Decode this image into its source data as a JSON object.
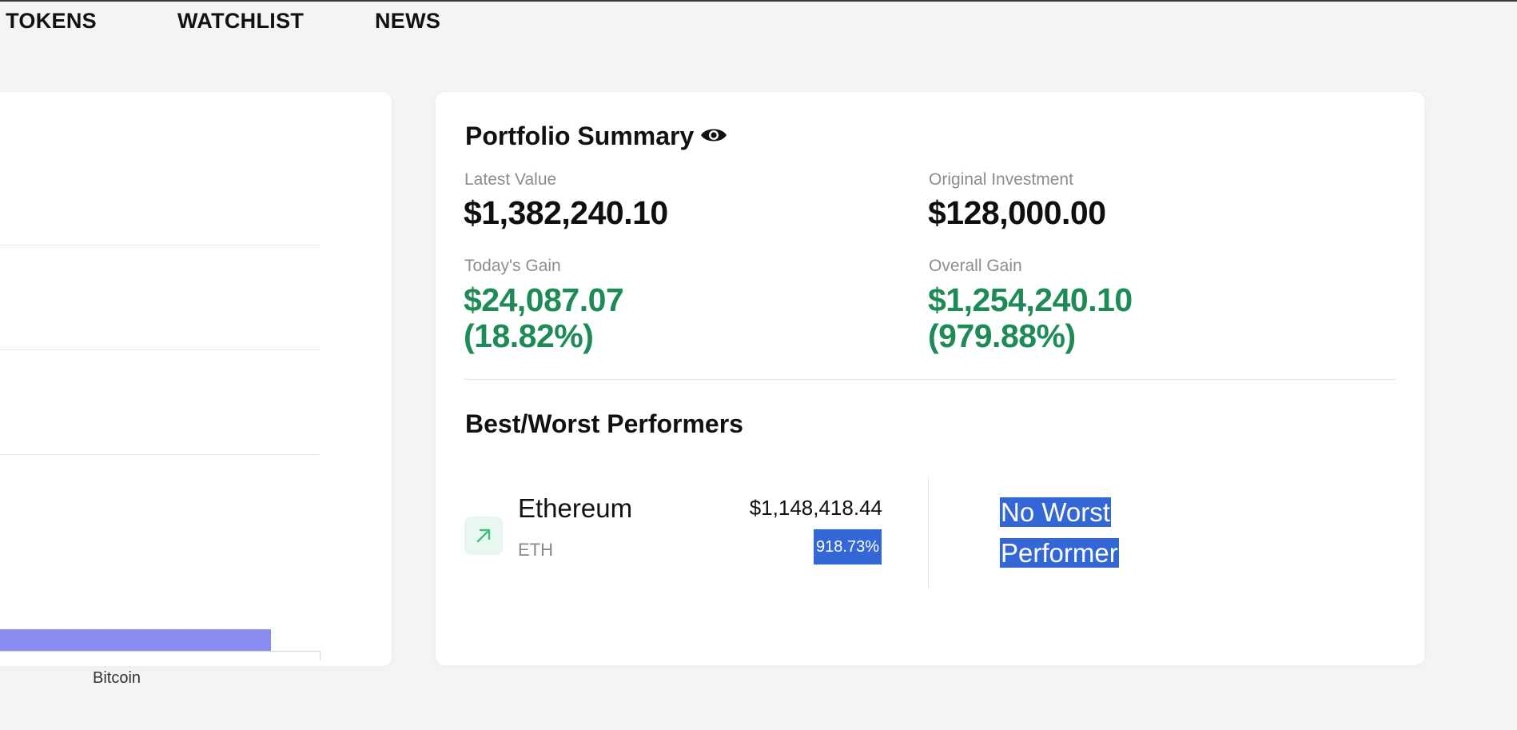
{
  "nav": {
    "items": [
      {
        "label": "O TOKENS"
      },
      {
        "label": "WATCHLIST"
      },
      {
        "label": "NEWS"
      }
    ]
  },
  "chart_data": {
    "type": "bar",
    "categories": [
      "Bitcoin"
    ],
    "values": [
      null
    ],
    "title": "",
    "xlabel": "",
    "ylabel": "",
    "grid": true
  },
  "summary": {
    "title": "Portfolio Summary",
    "title_icon": "eye-icon",
    "latest_value_label": "Latest Value",
    "latest_value": "$1,382,240.10",
    "original_investment_label": "Original Investment",
    "original_investment": "$128,000.00",
    "todays_gain_label": "Today's Gain",
    "todays_gain_amount": "$24,087.07",
    "todays_gain_pct": "(18.82%)",
    "overall_gain_label": "Overall Gain",
    "overall_gain_amount": "$1,254,240.10",
    "overall_gain_pct": "(979.88%)"
  },
  "performers": {
    "title": "Best/Worst Performers",
    "best": {
      "icon": "arrow-up-right-icon",
      "name": "Ethereum",
      "symbol": "ETH",
      "value": "$1,148,418.44",
      "pct": "918.73%"
    },
    "worst_empty_label": "No Worst Performer"
  },
  "colors": {
    "gain": "#1e8a55",
    "bar": "#8a8cf1",
    "selection": "#3367d6"
  }
}
